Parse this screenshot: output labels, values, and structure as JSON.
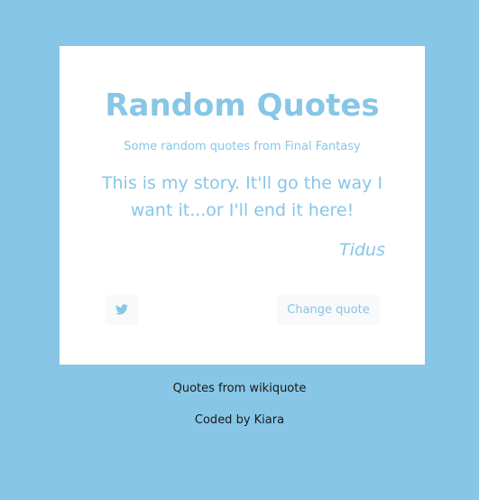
{
  "card": {
    "title": "Random Quotes",
    "subtitle": "Some random quotes from Final Fantasy",
    "quote": "This is my story. It'll go the way I want it...or I'll end it here!",
    "author": "Tidus",
    "tweet_icon": "twitter-icon",
    "change_label": "Change quote"
  },
  "footer": {
    "source": "Quotes from wikiquote",
    "credit": "Coded by Kiara"
  },
  "colors": {
    "background": "#87c6e6",
    "accent": "#87c6e6",
    "card": "#ffffff",
    "button": "#f8f9fa"
  }
}
